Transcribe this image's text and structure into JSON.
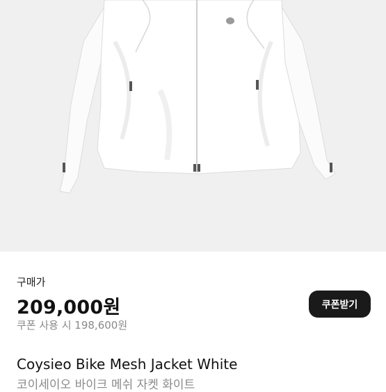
{
  "product": {
    "image_alt_name": "white-mesh-jacket-photo",
    "price_label": "구매가",
    "price": "209,000원",
    "coupon_button_label": "쿠폰받기",
    "coupon_price": "쿠폰 사용 시 198,600원",
    "title_en": "Coysieo Bike Mesh Jacket White",
    "title_ko": "코이세이오 바이크 메쉬 자켓 화이트"
  },
  "colors": {
    "image_background": "#f0f0f0",
    "button_background": "#1a1a1a",
    "muted_text": "#8a8a8a"
  }
}
